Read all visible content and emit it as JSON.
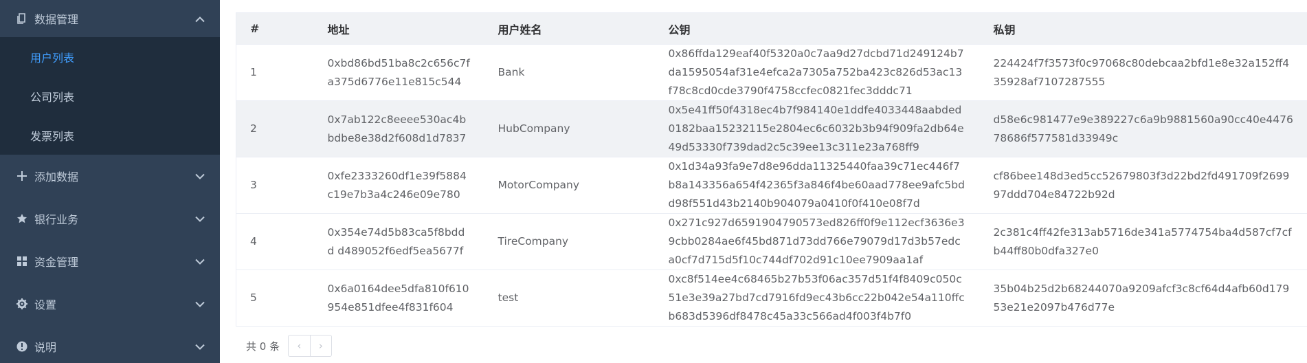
{
  "sidebar": {
    "group_data": {
      "label": "数据管理",
      "icon": "document-icon"
    },
    "sub_items": [
      {
        "label": "用户列表",
        "active": true
      },
      {
        "label": "公司列表"
      },
      {
        "label": "发票列表"
      }
    ],
    "menus": [
      {
        "label": "添加数据",
        "icon": "plus-icon"
      },
      {
        "label": "银行业务",
        "icon": "star-icon"
      },
      {
        "label": "资金管理",
        "icon": "grid-icon"
      },
      {
        "label": "设置",
        "icon": "gear-icon"
      },
      {
        "label": "说明",
        "icon": "info-icon"
      }
    ]
  },
  "table": {
    "headers": [
      "#",
      "地址",
      "用户姓名",
      "公钥",
      "私钥"
    ],
    "rows": [
      {
        "index": "1",
        "address": "0xbd86bd51ba8c2c656c7fa375d6776e11e815c544",
        "name": "Bank",
        "public_key": "0x86ffda129eaf40f5320a0c7aa9d27dcbd71d249124b7da1595054af31e4efca2a7305a752ba423c826d53ac13f78c8cd0cde3790f4758ccfec0821fec3dddc71",
        "private_key": "224424f7f3573f0c97068c80debcaa2bfd1e8e32a152ff435928af7107287555"
      },
      {
        "index": "2",
        "address": "0x7ab122c8eeee530ac4bbdbe8e38d2f608d1d7837",
        "name": "HubCompany",
        "public_key": "0x5e41ff50f4318ec4b7f984140e1ddfe4033448aabded0182baa15232115e2804ec6c6032b3b94f909fa2db64e49d53330f739dad2c5c39ee13c311e23a768ff9",
        "private_key": "d58e6c981477e9e389227c6a9b9881560a90cc40e447678686f577581d33949c"
      },
      {
        "index": "3",
        "address": "0xfe2333260df1e39f5884c19e7b3a4c246e09e780",
        "name": "MotorCompany",
        "public_key": "0x1d34a93fa9e7d8e96dda11325440faa39c71ec446f7b8a143356a654f42365f3a846f4be60aad778ee9afc5bdd98f551d43b2140b904079a0410f0f410e08f7d",
        "private_key": "cf86bee148d3ed5cc52679803f3d22bd2fd491709f269997ddd704e84722b92d"
      },
      {
        "index": "4",
        "address": "0x354e74d5b83ca5f8bddd d489052f6edf5ea5677f",
        "name": "TireCompany",
        "public_key": "0x271c927d6591904790573ed826ff0f9e112ecf3636e39cbb0284ae6f45bd871d73dd766e79079d17d3b57edca0cf7d715d5f10c744df702d91c10ee7909aa1af",
        "private_key": "2c381c4ff42fe313ab5716de341a5774754ba4d587cf7cfb44ff80b0dfa327e0"
      },
      {
        "index": "5",
        "address": "0x6a0164dee5dfa810f610954e851dfee4f831f604",
        "name": "test",
        "public_key": "0xc8f514ee4c68465b27b53f06ac357d51f4f8409c050c51e3e39a27bd7cd7916fd9ec43b6cc22b042e54a110ffcb683d5396df8478c45a33c566ad4f003f4b7f0",
        "private_key": "35b04b25d2b68244070a9209afcf3c8cf64d4afb60d17953e21e2097b476d77e"
      }
    ]
  },
  "pagination": {
    "total": "共 0 条",
    "prev": "‹",
    "next": "›"
  },
  "colors": {
    "sidebar_bg": "#304156",
    "submenu_bg": "#1f2d3d",
    "active": "#409eff"
  }
}
